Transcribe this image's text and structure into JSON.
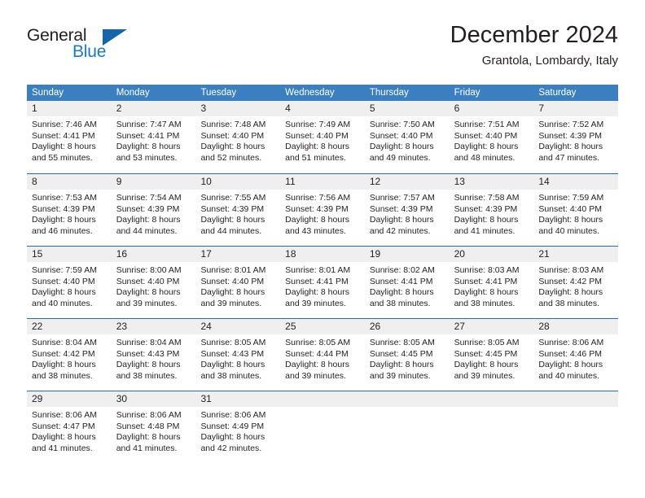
{
  "brand": {
    "name_part1": "General",
    "name_part2": "Blue",
    "logo_icon": "triangle-logo-icon"
  },
  "header": {
    "title": "December 2024",
    "subtitle": "Grantola, Lombardy, Italy"
  },
  "calendar": {
    "weekdays": [
      "Sunday",
      "Monday",
      "Tuesday",
      "Wednesday",
      "Thursday",
      "Friday",
      "Saturday"
    ],
    "accent_color": "#3c7fc1",
    "separator_color": "#1f6cb0",
    "day_band_color": "#efefef",
    "weeks": [
      [
        {
          "day": "1",
          "sunrise": "Sunrise: 7:46 AM",
          "sunset": "Sunset: 4:41 PM",
          "daylight_line1": "Daylight: 8 hours",
          "daylight_line2": "and 55 minutes."
        },
        {
          "day": "2",
          "sunrise": "Sunrise: 7:47 AM",
          "sunset": "Sunset: 4:41 PM",
          "daylight_line1": "Daylight: 8 hours",
          "daylight_line2": "and 53 minutes."
        },
        {
          "day": "3",
          "sunrise": "Sunrise: 7:48 AM",
          "sunset": "Sunset: 4:40 PM",
          "daylight_line1": "Daylight: 8 hours",
          "daylight_line2": "and 52 minutes."
        },
        {
          "day": "4",
          "sunrise": "Sunrise: 7:49 AM",
          "sunset": "Sunset: 4:40 PM",
          "daylight_line1": "Daylight: 8 hours",
          "daylight_line2": "and 51 minutes."
        },
        {
          "day": "5",
          "sunrise": "Sunrise: 7:50 AM",
          "sunset": "Sunset: 4:40 PM",
          "daylight_line1": "Daylight: 8 hours",
          "daylight_line2": "and 49 minutes."
        },
        {
          "day": "6",
          "sunrise": "Sunrise: 7:51 AM",
          "sunset": "Sunset: 4:40 PM",
          "daylight_line1": "Daylight: 8 hours",
          "daylight_line2": "and 48 minutes."
        },
        {
          "day": "7",
          "sunrise": "Sunrise: 7:52 AM",
          "sunset": "Sunset: 4:39 PM",
          "daylight_line1": "Daylight: 8 hours",
          "daylight_line2": "and 47 minutes."
        }
      ],
      [
        {
          "day": "8",
          "sunrise": "Sunrise: 7:53 AM",
          "sunset": "Sunset: 4:39 PM",
          "daylight_line1": "Daylight: 8 hours",
          "daylight_line2": "and 46 minutes."
        },
        {
          "day": "9",
          "sunrise": "Sunrise: 7:54 AM",
          "sunset": "Sunset: 4:39 PM",
          "daylight_line1": "Daylight: 8 hours",
          "daylight_line2": "and 44 minutes."
        },
        {
          "day": "10",
          "sunrise": "Sunrise: 7:55 AM",
          "sunset": "Sunset: 4:39 PM",
          "daylight_line1": "Daylight: 8 hours",
          "daylight_line2": "and 44 minutes."
        },
        {
          "day": "11",
          "sunrise": "Sunrise: 7:56 AM",
          "sunset": "Sunset: 4:39 PM",
          "daylight_line1": "Daylight: 8 hours",
          "daylight_line2": "and 43 minutes."
        },
        {
          "day": "12",
          "sunrise": "Sunrise: 7:57 AM",
          "sunset": "Sunset: 4:39 PM",
          "daylight_line1": "Daylight: 8 hours",
          "daylight_line2": "and 42 minutes."
        },
        {
          "day": "13",
          "sunrise": "Sunrise: 7:58 AM",
          "sunset": "Sunset: 4:39 PM",
          "daylight_line1": "Daylight: 8 hours",
          "daylight_line2": "and 41 minutes."
        },
        {
          "day": "14",
          "sunrise": "Sunrise: 7:59 AM",
          "sunset": "Sunset: 4:40 PM",
          "daylight_line1": "Daylight: 8 hours",
          "daylight_line2": "and 40 minutes."
        }
      ],
      [
        {
          "day": "15",
          "sunrise": "Sunrise: 7:59 AM",
          "sunset": "Sunset: 4:40 PM",
          "daylight_line1": "Daylight: 8 hours",
          "daylight_line2": "and 40 minutes."
        },
        {
          "day": "16",
          "sunrise": "Sunrise: 8:00 AM",
          "sunset": "Sunset: 4:40 PM",
          "daylight_line1": "Daylight: 8 hours",
          "daylight_line2": "and 39 minutes."
        },
        {
          "day": "17",
          "sunrise": "Sunrise: 8:01 AM",
          "sunset": "Sunset: 4:40 PM",
          "daylight_line1": "Daylight: 8 hours",
          "daylight_line2": "and 39 minutes."
        },
        {
          "day": "18",
          "sunrise": "Sunrise: 8:01 AM",
          "sunset": "Sunset: 4:41 PM",
          "daylight_line1": "Daylight: 8 hours",
          "daylight_line2": "and 39 minutes."
        },
        {
          "day": "19",
          "sunrise": "Sunrise: 8:02 AM",
          "sunset": "Sunset: 4:41 PM",
          "daylight_line1": "Daylight: 8 hours",
          "daylight_line2": "and 38 minutes."
        },
        {
          "day": "20",
          "sunrise": "Sunrise: 8:03 AM",
          "sunset": "Sunset: 4:41 PM",
          "daylight_line1": "Daylight: 8 hours",
          "daylight_line2": "and 38 minutes."
        },
        {
          "day": "21",
          "sunrise": "Sunrise: 8:03 AM",
          "sunset": "Sunset: 4:42 PM",
          "daylight_line1": "Daylight: 8 hours",
          "daylight_line2": "and 38 minutes."
        }
      ],
      [
        {
          "day": "22",
          "sunrise": "Sunrise: 8:04 AM",
          "sunset": "Sunset: 4:42 PM",
          "daylight_line1": "Daylight: 8 hours",
          "daylight_line2": "and 38 minutes."
        },
        {
          "day": "23",
          "sunrise": "Sunrise: 8:04 AM",
          "sunset": "Sunset: 4:43 PM",
          "daylight_line1": "Daylight: 8 hours",
          "daylight_line2": "and 38 minutes."
        },
        {
          "day": "24",
          "sunrise": "Sunrise: 8:05 AM",
          "sunset": "Sunset: 4:43 PM",
          "daylight_line1": "Daylight: 8 hours",
          "daylight_line2": "and 38 minutes."
        },
        {
          "day": "25",
          "sunrise": "Sunrise: 8:05 AM",
          "sunset": "Sunset: 4:44 PM",
          "daylight_line1": "Daylight: 8 hours",
          "daylight_line2": "and 39 minutes."
        },
        {
          "day": "26",
          "sunrise": "Sunrise: 8:05 AM",
          "sunset": "Sunset: 4:45 PM",
          "daylight_line1": "Daylight: 8 hours",
          "daylight_line2": "and 39 minutes."
        },
        {
          "day": "27",
          "sunrise": "Sunrise: 8:05 AM",
          "sunset": "Sunset: 4:45 PM",
          "daylight_line1": "Daylight: 8 hours",
          "daylight_line2": "and 39 minutes."
        },
        {
          "day": "28",
          "sunrise": "Sunrise: 8:06 AM",
          "sunset": "Sunset: 4:46 PM",
          "daylight_line1": "Daylight: 8 hours",
          "daylight_line2": "and 40 minutes."
        }
      ],
      [
        {
          "day": "29",
          "sunrise": "Sunrise: 8:06 AM",
          "sunset": "Sunset: 4:47 PM",
          "daylight_line1": "Daylight: 8 hours",
          "daylight_line2": "and 41 minutes."
        },
        {
          "day": "30",
          "sunrise": "Sunrise: 8:06 AM",
          "sunset": "Sunset: 4:48 PM",
          "daylight_line1": "Daylight: 8 hours",
          "daylight_line2": "and 41 minutes."
        },
        {
          "day": "31",
          "sunrise": "Sunrise: 8:06 AM",
          "sunset": "Sunset: 4:49 PM",
          "daylight_line1": "Daylight: 8 hours",
          "daylight_line2": "and 42 minutes."
        },
        {
          "day": "",
          "sunrise": "",
          "sunset": "",
          "daylight_line1": "",
          "daylight_line2": ""
        },
        {
          "day": "",
          "sunrise": "",
          "sunset": "",
          "daylight_line1": "",
          "daylight_line2": ""
        },
        {
          "day": "",
          "sunrise": "",
          "sunset": "",
          "daylight_line1": "",
          "daylight_line2": ""
        },
        {
          "day": "",
          "sunrise": "",
          "sunset": "",
          "daylight_line1": "",
          "daylight_line2": ""
        }
      ]
    ]
  }
}
